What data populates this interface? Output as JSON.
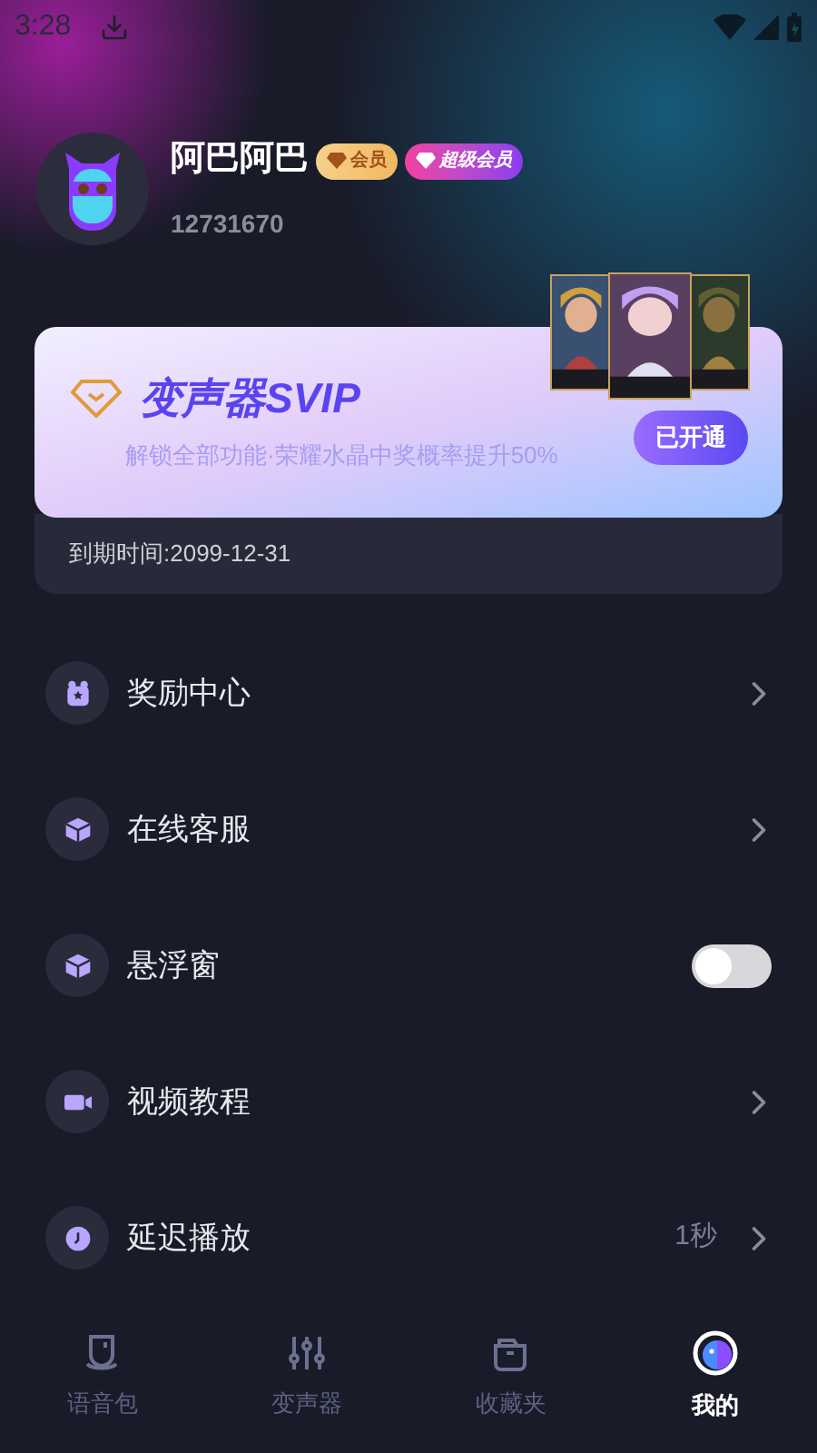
{
  "status_bar": {
    "time": "3:28"
  },
  "profile": {
    "name": "阿巴阿巴",
    "badges": [
      {
        "kind": "vip",
        "label": "会员"
      },
      {
        "kind": "svip",
        "label": "超级会员"
      }
    ],
    "user_id": "12731670"
  },
  "svip_card": {
    "title": "变声器SVIP",
    "subtitle": "解锁全部功能·荣耀水晶中奖概率提升50%",
    "button": "已开通",
    "expiry": "到期时间:2099-12-31"
  },
  "menu": [
    {
      "kind": "link",
      "label": "奖励中心"
    },
    {
      "kind": "link",
      "label": "在线客服"
    },
    {
      "kind": "toggle",
      "label": "悬浮窗",
      "on": false
    },
    {
      "kind": "link",
      "label": "视频教程"
    },
    {
      "kind": "link",
      "label": "延迟播放",
      "value": "1秒"
    }
  ],
  "bottom_nav": [
    {
      "label": "语音包",
      "selected": false
    },
    {
      "label": "变声器",
      "selected": false
    },
    {
      "label": "收藏夹",
      "selected": false
    },
    {
      "label": "我的",
      "selected": true
    }
  ]
}
